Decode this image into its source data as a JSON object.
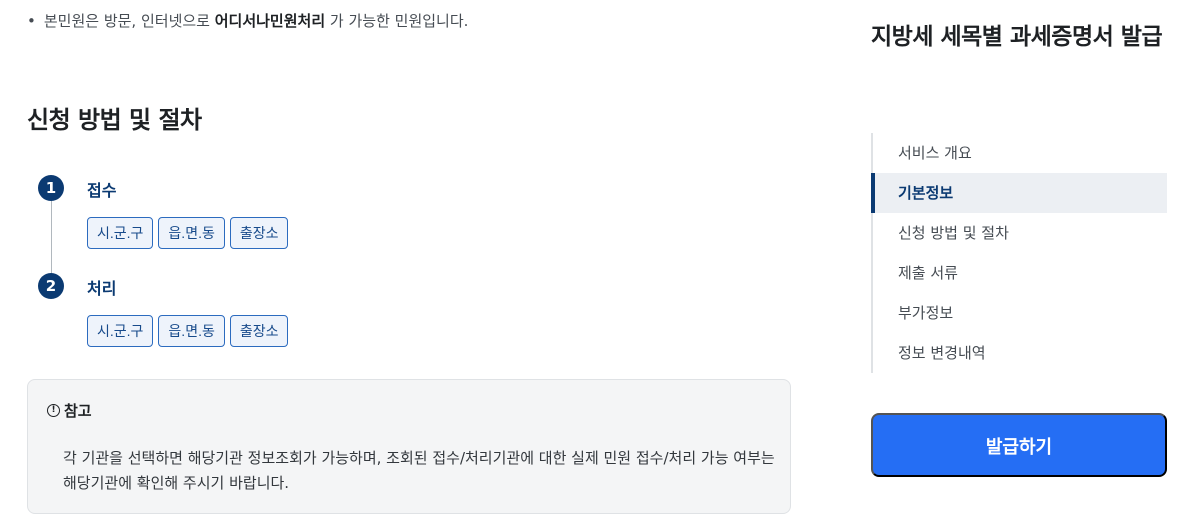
{
  "notice": {
    "bullet": "•",
    "prefix": "본민원은 방문, 인터넷으로 ",
    "highlight": "어디서나민원처리",
    "suffix": " 가 가능한 민원입니다."
  },
  "section": {
    "title": "신청 방법 및 절차"
  },
  "steps": [
    {
      "number": "1",
      "label": "접수",
      "tags": [
        "시.군.구",
        "읍.면.동",
        "출장소"
      ]
    },
    {
      "number": "2",
      "label": "처리",
      "tags": [
        "시.군.구",
        "읍.면.동",
        "출장소"
      ]
    }
  ],
  "note": {
    "icon": "info-circle-icon",
    "title": "참고",
    "body": "각 기관을 선택하면 해당기관 정보조회가 가능하며, 조회된 접수/처리기관에 대한 실제 민원 접수/처리 가능 여부는 해당기관에 확인해 주시기 바랍니다."
  },
  "aside": {
    "title": "지방세 세목별 과세증명서 발급",
    "toc": [
      {
        "label": "서비스 개요",
        "active": false
      },
      {
        "label": "기본정보",
        "active": true
      },
      {
        "label": "신청 방법 및 절차",
        "active": false
      },
      {
        "label": "제출 서류",
        "active": false
      },
      {
        "label": "부가정보",
        "active": false
      },
      {
        "label": "정보 변경내역",
        "active": false
      }
    ],
    "apply_button": "발급하기"
  },
  "colors": {
    "primary_navy": "#0b3a72",
    "button_blue": "#256ef4",
    "tag_border": "#2c6bbf"
  }
}
